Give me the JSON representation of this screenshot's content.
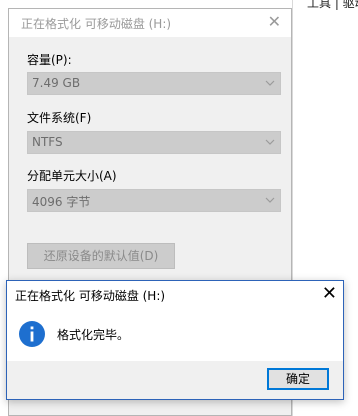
{
  "background_window": {
    "text": "工具 | 驱动"
  },
  "format_dialog": {
    "title": "正在格式化 可移动磁盘 (H:)",
    "close_glyph": "✕",
    "capacity": {
      "label": "容量(P):",
      "value": "7.49 GB"
    },
    "filesystem": {
      "label": "文件系统(F)",
      "value": "NTFS"
    },
    "allocation": {
      "label": "分配单元大小(A)",
      "value": "4096 字节"
    },
    "restore_button": "还原设备的默认值(D)"
  },
  "message_box": {
    "title": "正在格式化 可移动磁盘 (H:)",
    "close_glyph": "✕",
    "icon": "info-icon",
    "message": "格式化完毕。",
    "ok_button": "确定",
    "colors": {
      "info_blue": "#1e6fcf",
      "accent": "#0078d7"
    }
  }
}
